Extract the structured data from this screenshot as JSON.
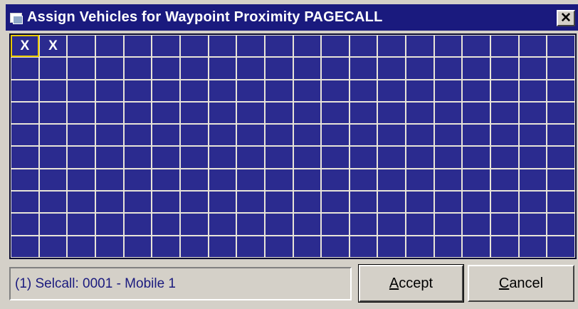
{
  "window": {
    "title": "Assign Vehicles for Waypoint Proximity PAGECALL",
    "close_label": "✕"
  },
  "grid": {
    "rows": 10,
    "cols": 20,
    "marked": [
      {
        "row": 0,
        "col": 0,
        "mark": "X",
        "selected": true
      },
      {
        "row": 0,
        "col": 1,
        "mark": "X",
        "selected": false
      }
    ]
  },
  "status": {
    "text": "(1) Selcall: 0001 - Mobile 1"
  },
  "buttons": {
    "accept_first": "A",
    "accept_rest": "ccept",
    "cancel_first": "C",
    "cancel_rest": "ancel"
  },
  "colors": {
    "titlebar": "#1a1a7e",
    "grid_cell": "#2b2b8f",
    "grid_line": "#e8e4d8",
    "selection": "#e8c800"
  }
}
